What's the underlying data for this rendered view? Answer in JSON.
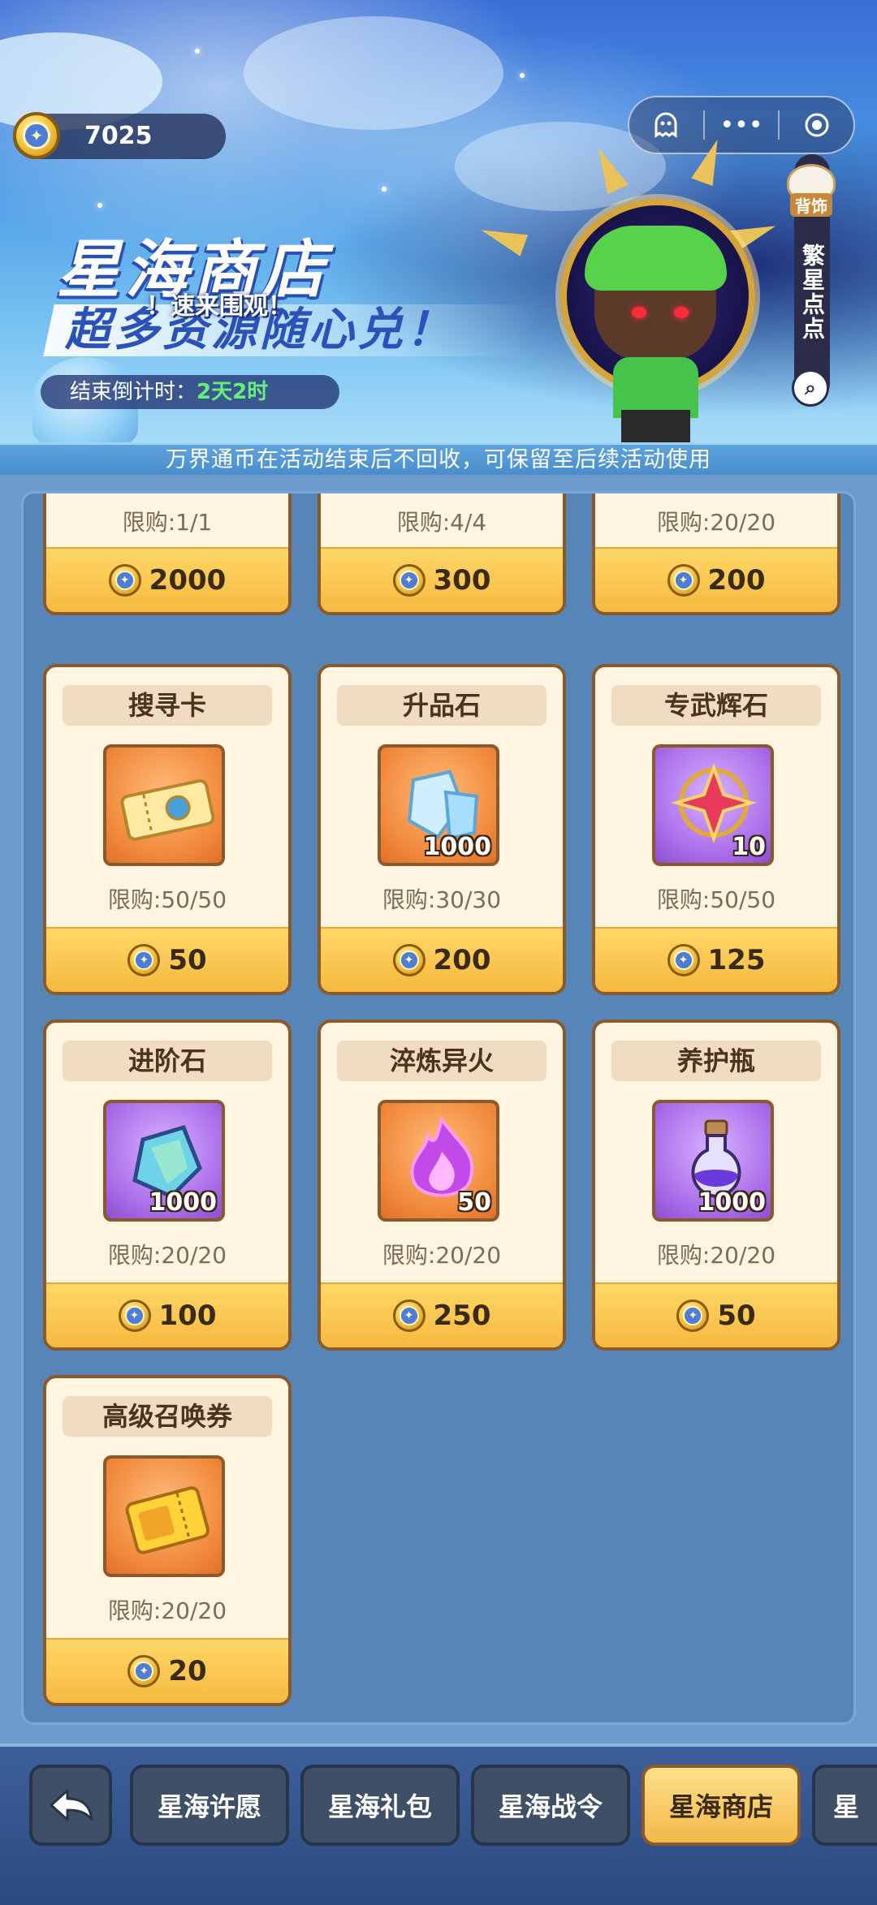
{
  "header": {
    "currency_amount": "7025",
    "title": "星海商店",
    "tag": "！速来围观！",
    "subtitle": "超多资源随心兑！",
    "countdown_label": "结束倒计时：",
    "countdown_value": "2天2时",
    "notice": "万界通币在活动结束后不回收，可保留至后续活动使用",
    "side_badge": "背饰",
    "side_label": "繁星点点"
  },
  "top_row": [
    {
      "limit": "限购:1/1",
      "price": "2000"
    },
    {
      "limit": "限购:4/4",
      "price": "300"
    },
    {
      "limit": "限购:20/20",
      "price": "200"
    }
  ],
  "items": [
    {
      "name": "搜寻卡",
      "limit": "限购:50/50",
      "price": "50",
      "qty": "",
      "bg": "orange",
      "icon": "ticket-icon"
    },
    {
      "name": "升品石",
      "limit": "限购:30/30",
      "price": "200",
      "qty": "1000",
      "bg": "orange",
      "icon": "crystal-icon"
    },
    {
      "name": "专武辉石",
      "limit": "限购:50/50",
      "price": "125",
      "qty": "10",
      "bg": "purple",
      "icon": "star-gem-icon"
    },
    {
      "name": "进阶石",
      "limit": "限购:20/20",
      "price": "100",
      "qty": "1000",
      "bg": "purple",
      "icon": "stone-icon"
    },
    {
      "name": "淬炼异火",
      "limit": "限购:20/20",
      "price": "250",
      "qty": "50",
      "bg": "orange",
      "icon": "flame-icon"
    },
    {
      "name": "养护瓶",
      "limit": "限购:20/20",
      "price": "50",
      "qty": "1000",
      "bg": "purple",
      "icon": "potion-icon"
    },
    {
      "name": "高级召唤券",
      "limit": "限购:20/20",
      "price": "20",
      "qty": "",
      "bg": "orange",
      "icon": "summon-ticket-icon"
    }
  ],
  "nav": {
    "back": "back-arrow-icon",
    "tabs": [
      "星海许愿",
      "星海礼包",
      "星海战令",
      "星海商店",
      "星"
    ],
    "active_index": 3
  },
  "colors": {
    "price_bar": "#f5b940",
    "card_bg": "#fff5e1",
    "active_tab": "#f2b94a",
    "countdown_green": "#65f07a"
  }
}
